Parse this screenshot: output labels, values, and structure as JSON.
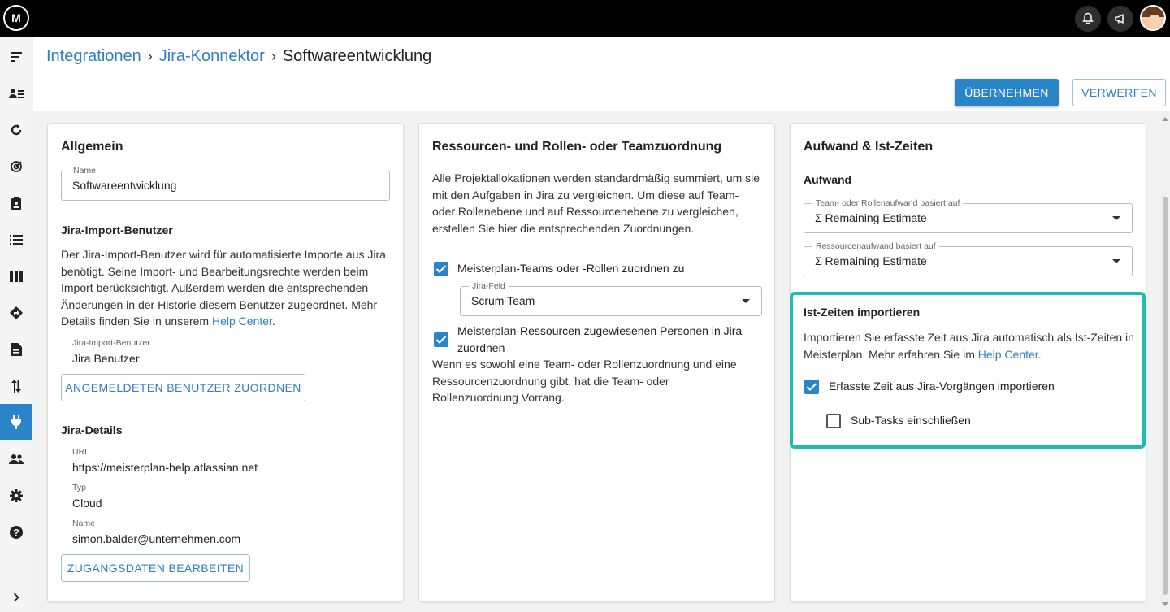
{
  "topbar": {
    "logo_text": "M",
    "icons": [
      "bell-icon",
      "megaphone-icon"
    ]
  },
  "sidebar": {
    "items": [
      {
        "name": "menu-icon"
      },
      {
        "name": "portfolio-icon"
      },
      {
        "name": "refresh-icon"
      },
      {
        "name": "target-icon"
      },
      {
        "name": "clipboard-icon"
      },
      {
        "name": "list-icon"
      },
      {
        "name": "columns-icon"
      },
      {
        "name": "roadmap-icon"
      },
      {
        "name": "document-icon"
      },
      {
        "name": "sync-icon"
      },
      {
        "name": "plug-icon",
        "active": true
      },
      {
        "name": "people-icon"
      },
      {
        "name": "gear-icon"
      },
      {
        "name": "help-icon"
      },
      {
        "name": "expand-chevron-icon"
      }
    ]
  },
  "breadcrumb": {
    "items": [
      "Integrationen",
      "Jira-Konnektor"
    ],
    "current": "Softwareentwicklung"
  },
  "actions": {
    "apply": "ÜBERNEHMEN",
    "discard": "VERWERFEN"
  },
  "general": {
    "title": "Allgemein",
    "name_label": "Name",
    "name_value": "Softwareentwicklung",
    "import_user_title": "Jira-Import-Benutzer",
    "import_user_desc": "Der Jira-Import-Benutzer wird für automatisierte Importe aus Jira benötigt. Seine Import- und Bearbeitungsrechte werden beim Import berücksichtigt. Außerdem werden die entsprechenden Änderungen in der Historie diesem Benutzer zugeordnet. Mehr Details finden Sie in unserem ",
    "import_user_link": "Help Center",
    "import_user_label": "Jira-Import-Benutzer",
    "import_user_value": "Jira Benutzer",
    "assign_button": "ANGEMELDETEN BENUTZER ZUORDNEN",
    "details_title": "Jira-Details",
    "url_label": "URL",
    "url_value": "https://meisterplan-help.atlassian.net",
    "type_label": "Typ",
    "type_value": "Cloud",
    "account_label": "Name",
    "account_value": "simon.balder@unternehmen.com",
    "edit_credentials_button": "ZUGANGSDATEN BEARBEITEN"
  },
  "resources": {
    "title": "Ressourcen- und Rollen- oder Teamzuordnung",
    "desc": "Alle Projektallokationen werden standardmäßig summiert, um sie mit den Aufgaben in Jira zu vergleichen. Um diese auf Team- oder Rollenebene und auf Ressourcenebene zu vergleichen, erstellen Sie hier die entsprechenden Zuordnungen.",
    "map_teams_label": "Meisterplan-Teams oder -Rollen zuordnen zu",
    "map_teams_checked": true,
    "jira_field_label": "Jira-Feld",
    "jira_field_value": "Scrum Team",
    "map_resources_label": "Meisterplan-Ressourcen zugewiesenen Personen in Jira zuordnen",
    "map_resources_checked": true,
    "priority_note": "Wenn es sowohl eine Team- oder Rollenzuordnung und eine Ressourcenzuordnung gibt, hat die Team- oder Rollenzuordnung Vorrang."
  },
  "effort": {
    "title": "Aufwand & Ist-Zeiten",
    "effort_subtitle": "Aufwand",
    "team_effort_label": "Team- oder Rollenaufwand basiert auf",
    "team_effort_value": "Σ Remaining Estimate",
    "resource_effort_label": "Ressourcenaufwand basiert auf",
    "resource_effort_value": "Σ Remaining Estimate",
    "actuals_title": "Ist-Zeiten importieren",
    "actuals_desc": "Importieren Sie erfasste Zeit aus Jira automatisch als Ist-Zeiten in Meisterplan. Mehr erfahren Sie im ",
    "actuals_link": "Help Center",
    "import_time_label": "Erfasste Zeit aus Jira-Vorgängen importieren",
    "import_time_checked": true,
    "subtasks_label": "Sub-Tasks einschließen",
    "subtasks_checked": false
  },
  "colors": {
    "accent": "#2a85c8",
    "link": "#2f7fc1",
    "highlight": "#1fbdb0"
  }
}
